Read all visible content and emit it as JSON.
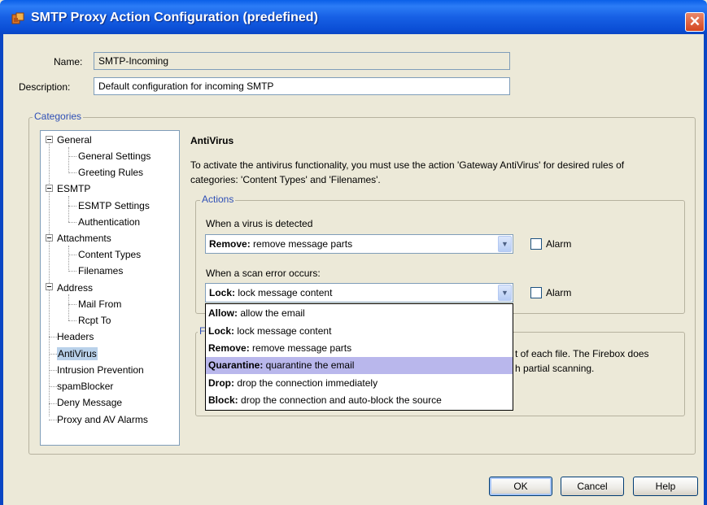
{
  "window": {
    "title": "SMTP Proxy Action Configuration (predefined)",
    "close_glyph": "✕",
    "icon": "firebox-icon",
    "title_bar_color": "#1760E5"
  },
  "form": {
    "name_label": "Name:",
    "name_value": "SMTP-Incoming",
    "description_label": "Description:",
    "description_value": "Default configuration for incoming SMTP"
  },
  "categories": {
    "title": "Categories",
    "tree": [
      {
        "label": "General",
        "level": 0,
        "expanded": true
      },
      {
        "label": "General Settings",
        "level": 1
      },
      {
        "label": "Greeting Rules",
        "level": 1
      },
      {
        "label": "ESMTP",
        "level": 0,
        "expanded": true
      },
      {
        "label": "ESMTP Settings",
        "level": 1
      },
      {
        "label": "Authentication",
        "level": 1
      },
      {
        "label": "Attachments",
        "level": 0,
        "expanded": true
      },
      {
        "label": "Content Types",
        "level": 1
      },
      {
        "label": "Filenames",
        "level": 1
      },
      {
        "label": "Address",
        "level": 0,
        "expanded": true
      },
      {
        "label": "Mail From",
        "level": 1
      },
      {
        "label": "Rcpt To",
        "level": 1
      },
      {
        "label": "Headers",
        "level": 0
      },
      {
        "label": "AntiVirus",
        "level": 0,
        "selected": true
      },
      {
        "label": "Intrusion Prevention",
        "level": 0
      },
      {
        "label": "spamBlocker",
        "level": 0
      },
      {
        "label": "Deny Message",
        "level": 0
      },
      {
        "label": "Proxy and AV Alarms",
        "level": 0
      }
    ]
  },
  "antivirus": {
    "title": "AntiVirus",
    "description": "To activate the antivirus functionality, you must use the action 'Gateway AntiVirus' for desired rules of categories: 'Content Types' and 'Filenames'.",
    "actions_title": "Actions",
    "virus_detected_label": "When a virus is detected",
    "virus_action_bold": "Remove:",
    "virus_action_text": " remove message parts",
    "scan_error_label": "When a scan error occurs:",
    "scan_action_bold": "Lock:",
    "scan_action_text": " lock message content",
    "alarm_label": "Alarm",
    "partial_text_line1": "t of each file. The Firebox does",
    "partial_text_line2": "h partial scanning.",
    "hidden_group_title_fragment": "F"
  },
  "dropdown_options": [
    {
      "bold": "Allow:",
      "text": " allow the email"
    },
    {
      "bold": "Lock:",
      "text": " lock message content"
    },
    {
      "bold": "Remove:",
      "text": " remove message parts"
    },
    {
      "bold": "Quarantine:",
      "text": " quarantine the email",
      "highlighted": true
    },
    {
      "bold": "Drop:",
      "text": " drop the connection immediately"
    },
    {
      "bold": "Block:",
      "text": " drop the connection and auto-block the source"
    }
  ],
  "buttons": {
    "ok": "OK",
    "cancel": "Cancel",
    "help": "Help"
  },
  "colors": {
    "group_title": "#2E4FB6",
    "selection": "#B9D1EA",
    "dropdown_highlight": "#B9B7EC",
    "close_button": "#D4461F"
  }
}
